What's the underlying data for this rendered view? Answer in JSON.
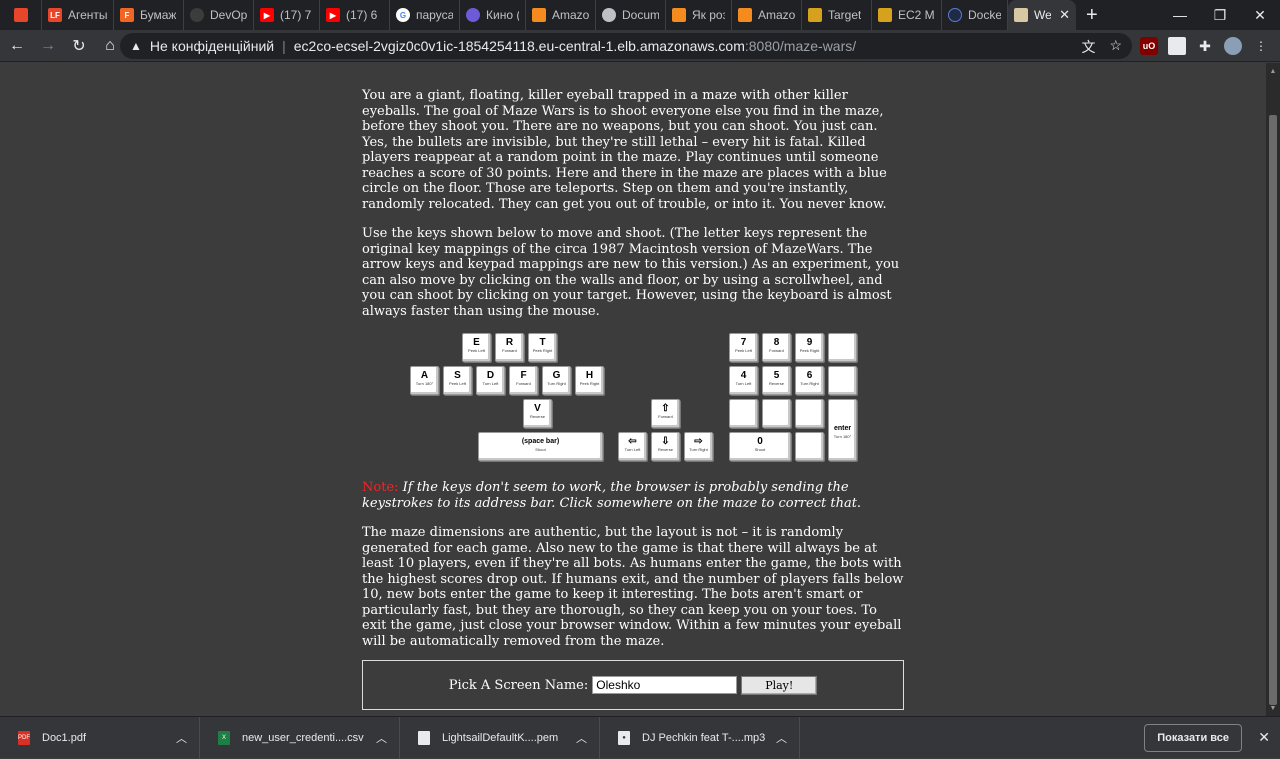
{
  "browser": {
    "tabs": [
      {
        "label": "",
        "icon": "brand-icon",
        "color": "#e8462b"
      },
      {
        "label": "Агенты",
        "icon": "lf-icon",
        "color": "#e8462b"
      },
      {
        "label": "Бумаж",
        "icon": "f-icon",
        "color": "#f26522"
      },
      {
        "label": "DevOp",
        "icon": "github-icon",
        "color": "#3c3c3c"
      },
      {
        "label": "(17) 7",
        "icon": "youtube-icon",
        "color": "#ff0000"
      },
      {
        "label": "(17) 6",
        "icon": "youtube-icon",
        "color": "#ff0000"
      },
      {
        "label": "паруса",
        "icon": "google-icon",
        "color": "#ffffff"
      },
      {
        "label": "Кино (",
        "icon": "kino-icon",
        "color": "#6b5bd6"
      },
      {
        "label": "Amazo",
        "icon": "aws-icon",
        "color": "#f58b1f"
      },
      {
        "label": "Docum",
        "icon": "chrome-icon",
        "color": "#bdc1c6"
      },
      {
        "label": "Як роз",
        "icon": "aws-icon",
        "color": "#f58b1f"
      },
      {
        "label": "Amazo",
        "icon": "aws-icon",
        "color": "#f58b1f"
      },
      {
        "label": "Target",
        "icon": "box-icon",
        "color": "#d6a11c"
      },
      {
        "label": "EC2 M",
        "icon": "box-icon",
        "color": "#d6a11c"
      },
      {
        "label": "Docker",
        "icon": "docker-icon",
        "color": "#1f2a44"
      },
      {
        "label": "Wel",
        "icon": "mazewars-icon",
        "color": "#d9c9a3",
        "active": true
      }
    ],
    "address": {
      "security_label": "Не конфіденційний",
      "host": "ec2co-ecsel-2vgiz0c0v1ic-1854254118.eu-central-1.elb.amazonaws.com",
      "port_path": ":8080/maze-wars/"
    }
  },
  "page": {
    "intro": "You are a giant, floating, killer eyeball trapped in a maze with other killer eyeballs. The goal of Maze Wars is to shoot everyone else you find in the maze, before they shoot you. There are no weapons, but you can shoot. You just can. Yes, the bullets are invisible, but they're still lethal – every hit is fatal. Killed players reappear at a random point in the maze. Play continues until someone reaches a score of 30 points. Here and there in the maze are places with a blue circle on the floor. Those are teleports. Step on them and you're instantly, randomly relocated. They can get you out of trouble, or into it. You never know.",
    "controls": "Use the keys shown below to move and shoot. (The letter keys represent the original key mappings of the circa 1987 Macintosh version of MazeWars. The arrow keys and keypad mappings are new to this version.) As an experiment, you can also move by clicking on the walls and floor, or by using a scrollwheel, and you can shoot by clicking on your target. However, using the keyboard is almost always faster than using the mouse.",
    "note_label": "Note:",
    "note_text": " If the keys don't seem to work, the browser is probably sending the keystrokes to its address bar. Click somewhere on the maze to correct that.",
    "layout_text": "The maze dimensions are authentic, but the layout is not – it is randomly generated for each game. Also new to the game is that there will always be at least 10 players, even if they're all bots. As humans enter the game, the bots with the highest scores drop out. If humans exit, and the number of players falls below 10, new bots enter the game to keep it interesting. The bots aren't smart or particularly fast, but they are thorough, so they can keep you on your toes. To exit the game, just close your browser window. Within a few minutes your eyeball will be automatically removed from the maze.",
    "form": {
      "label": "Pick A Screen Name:",
      "name_value": "Oleshko",
      "play_label": "Play!"
    }
  },
  "keyboard": {
    "keys": [
      {
        "key": "E",
        "sub": "Peek Left"
      },
      {
        "key": "R",
        "sub": "Forward"
      },
      {
        "key": "T",
        "sub": "Peek Right"
      },
      {
        "key": "A",
        "sub": "Turn 180°"
      },
      {
        "key": "S",
        "sub": "Peek Left"
      },
      {
        "key": "D",
        "sub": "Turn Left"
      },
      {
        "key": "F",
        "sub": "Forward"
      },
      {
        "key": "G",
        "sub": "Turn Right"
      },
      {
        "key": "H",
        "sub": "Peek Right"
      },
      {
        "key": "V",
        "sub": "Reverse"
      },
      {
        "key": "(space bar)",
        "sub": "Shoot"
      },
      {
        "key": "⇧",
        "sub": "Forward"
      },
      {
        "key": "⇦",
        "sub": "Turn Left"
      },
      {
        "key": "⇩",
        "sub": "Reverse"
      },
      {
        "key": "⇨",
        "sub": "Turn Right"
      },
      {
        "key": "7",
        "sub": "Peek Left"
      },
      {
        "key": "8",
        "sub": "Forward"
      },
      {
        "key": "9",
        "sub": "Peek Right"
      },
      {
        "key": "4",
        "sub": "Turn Left"
      },
      {
        "key": "5",
        "sub": "Reverse"
      },
      {
        "key": "6",
        "sub": "Turn Right"
      },
      {
        "key": "0",
        "sub": "Shoot"
      },
      {
        "key": "enter",
        "sub": "Turn 180°"
      }
    ]
  },
  "downloads": {
    "items": [
      {
        "name": "Doc1.pdf",
        "icon": "pdf-icon",
        "color": "#d93025"
      },
      {
        "name": "new_user_credenti....csv",
        "icon": "excel-icon",
        "color": "#1e7e45"
      },
      {
        "name": "LightsailDefaultK....pem",
        "icon": "file-icon",
        "color": "#e8eaed"
      },
      {
        "name": "DJ Pechkin feat T-....mp3",
        "icon": "audio-icon",
        "color": "#e8eaed"
      }
    ],
    "show_all": "Показати все"
  }
}
